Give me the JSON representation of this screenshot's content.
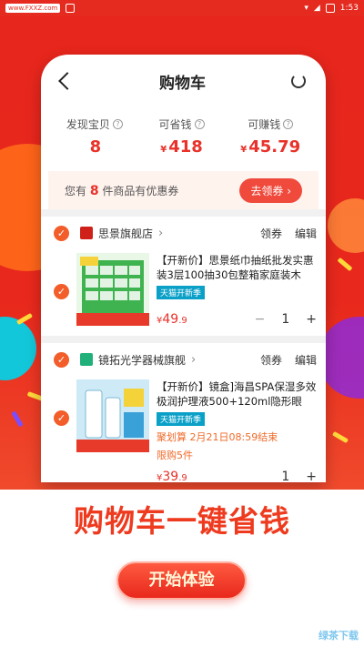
{
  "status": {
    "site": "www.FXXZ.com",
    "time": "1:53"
  },
  "header": {
    "title": "购物车"
  },
  "stats": [
    {
      "label": "发现宝贝",
      "value": "8",
      "currency": ""
    },
    {
      "label": "可省钱",
      "value": "418",
      "currency": "¥"
    },
    {
      "label": "可赚钱",
      "value": "45.79",
      "currency": "¥"
    }
  ],
  "coupon": {
    "prefix": "您有",
    "count": "8",
    "suffix": "件商品有优惠券",
    "button": "去领券 ›"
  },
  "shops": [
    {
      "name": "思景旗舰店",
      "action1": "领券",
      "action2": "编辑",
      "item": {
        "title": "【开新价】思景纸巾抽纸批发实惠装3层100抽30包整箱家庭装木",
        "tag": "天猫开新季",
        "currency": "¥",
        "price_int": "49",
        "price_dec": ".9",
        "qty": "1",
        "minus": "−",
        "plus": "+"
      }
    },
    {
      "name": "镜拓光学器械旗舰",
      "action1": "领券",
      "action2": "编辑",
      "item": {
        "title": "【开新价】镜盒]海昌SPA保湿多效极润护理液500+120ml隐形眼",
        "tag": "天猫开新季",
        "note1": "聚划算 2月21日08:59结束",
        "note2": "限购5件",
        "currency": "¥",
        "price_int": "39",
        "price_dec": ".9",
        "qty": "1",
        "plus": "+"
      }
    }
  ],
  "slogan": "购物车一键省钱",
  "start_button": "开始体验",
  "watermark": "绿茶下载",
  "colors": {
    "accent": "#e8322a",
    "hero": "#e7261d",
    "tag": "#0aa0c8"
  }
}
